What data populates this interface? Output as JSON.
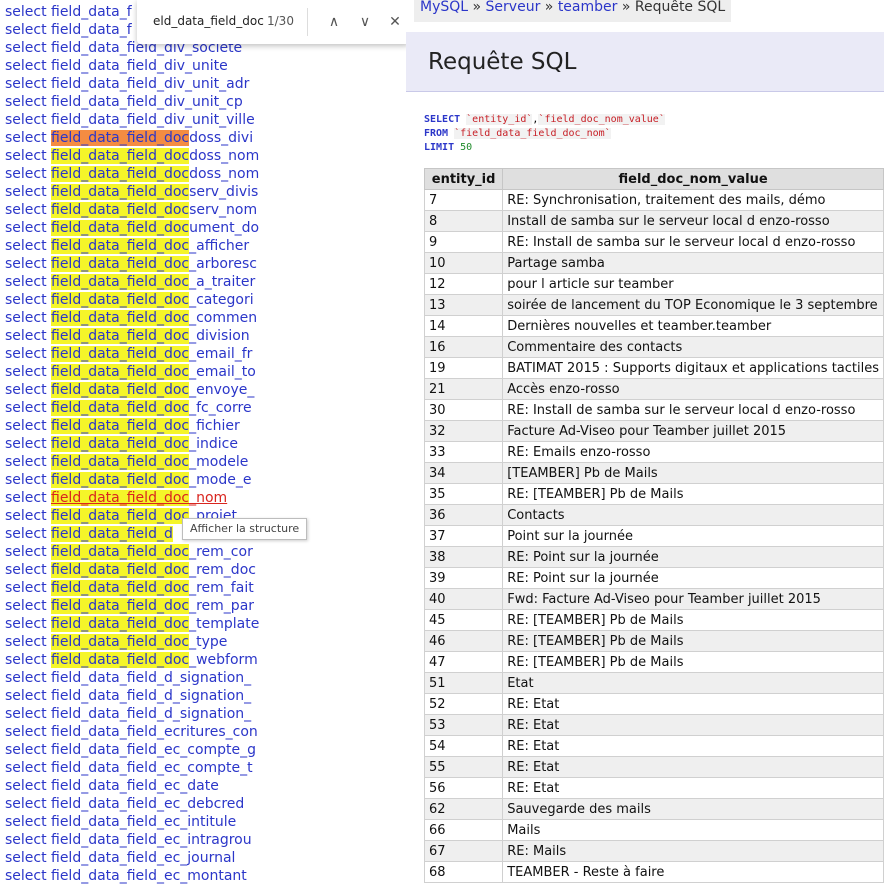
{
  "find_bar": {
    "query": "eld_data_field_doc",
    "count": "1/30",
    "prev": "∧",
    "next": "∨",
    "close": "✕"
  },
  "tooltip": "Afficher la structure",
  "left_list": [
    {
      "select": "select",
      "pre": "field_data_f",
      "hl": "",
      "suffix": ""
    },
    {
      "select": "select",
      "pre": "field_data_f",
      "hl": "",
      "suffix": ""
    },
    {
      "select": "select",
      "pre": "field_data_field_div_societe",
      "hl": "",
      "suffix": ""
    },
    {
      "select": "select",
      "pre": "field_data_field_div_unite",
      "hl": "",
      "suffix": ""
    },
    {
      "select": "select",
      "pre": "field_data_field_div_unit_adr",
      "hl": "",
      "suffix": ""
    },
    {
      "select": "select",
      "pre": "field_data_field_div_unit_cp",
      "hl": "",
      "suffix": ""
    },
    {
      "select": "select",
      "pre": "field_data_field_div_unit_ville",
      "hl": "",
      "suffix": ""
    },
    {
      "select": "select",
      "pre": "",
      "hl": "field_data_field_doc",
      "suffix": "doss_divi",
      "current": true
    },
    {
      "select": "select",
      "pre": "",
      "hl": "field_data_field_doc",
      "suffix": "doss_nom"
    },
    {
      "select": "select",
      "pre": "",
      "hl": "field_data_field_doc",
      "suffix": "doss_nom"
    },
    {
      "select": "select",
      "pre": "",
      "hl": "field_data_field_doc",
      "suffix": "serv_divis"
    },
    {
      "select": "select",
      "pre": "",
      "hl": "field_data_field_doc",
      "suffix": "serv_nom"
    },
    {
      "select": "select",
      "pre": "",
      "hl": "field_data_field_doc",
      "suffix": "ument_do"
    },
    {
      "select": "select",
      "pre": "",
      "hl": "field_data_field_doc",
      "suffix": "_afficher"
    },
    {
      "select": "select",
      "pre": "",
      "hl": "field_data_field_doc",
      "suffix": "_arboresc"
    },
    {
      "select": "select",
      "pre": "",
      "hl": "field_data_field_doc",
      "suffix": "_a_traiter"
    },
    {
      "select": "select",
      "pre": "",
      "hl": "field_data_field_doc",
      "suffix": "_categori"
    },
    {
      "select": "select",
      "pre": "",
      "hl": "field_data_field_doc",
      "suffix": "_commen"
    },
    {
      "select": "select",
      "pre": "",
      "hl": "field_data_field_doc",
      "suffix": "_division"
    },
    {
      "select": "select",
      "pre": "",
      "hl": "field_data_field_doc",
      "suffix": "_email_fr"
    },
    {
      "select": "select",
      "pre": "",
      "hl": "field_data_field_doc",
      "suffix": "_email_to"
    },
    {
      "select": "select",
      "pre": "",
      "hl": "field_data_field_doc",
      "suffix": "_envoye_"
    },
    {
      "select": "select",
      "pre": "",
      "hl": "field_data_field_doc",
      "suffix": "_fc_corre"
    },
    {
      "select": "select",
      "pre": "",
      "hl": "field_data_field_doc",
      "suffix": "_fichier"
    },
    {
      "select": "select",
      "pre": "",
      "hl": "field_data_field_doc",
      "suffix": "_indice"
    },
    {
      "select": "select",
      "pre": "",
      "hl": "field_data_field_doc",
      "suffix": "_modele"
    },
    {
      "select": "select",
      "pre": "",
      "hl": "field_data_field_doc",
      "suffix": "_mode_e"
    },
    {
      "select": "select",
      "pre": "",
      "hl": "field_data_field_doc",
      "suffix": "_nom",
      "hover": true
    },
    {
      "select": "select",
      "pre": "",
      "hl": "field_data_field_doc",
      "suffix": "_projet"
    },
    {
      "select": "select",
      "pre": "",
      "hl": "field_data_field_d",
      "suffix": ""
    },
    {
      "select": "select",
      "pre": "",
      "hl": "field_data_field_doc",
      "suffix": "_rem_cor"
    },
    {
      "select": "select",
      "pre": "",
      "hl": "field_data_field_doc",
      "suffix": "_rem_doc"
    },
    {
      "select": "select",
      "pre": "",
      "hl": "field_data_field_doc",
      "suffix": "_rem_fait"
    },
    {
      "select": "select",
      "pre": "",
      "hl": "field_data_field_doc",
      "suffix": "_rem_par"
    },
    {
      "select": "select",
      "pre": "",
      "hl": "field_data_field_doc",
      "suffix": "_template"
    },
    {
      "select": "select",
      "pre": "",
      "hl": "field_data_field_doc",
      "suffix": "_type"
    },
    {
      "select": "select",
      "pre": "",
      "hl": "field_data_field_doc",
      "suffix": "_webform"
    },
    {
      "select": "select",
      "pre": "field_data_field_d_signation_",
      "hl": "",
      "suffix": ""
    },
    {
      "select": "select",
      "pre": "field_data_field_d_signation_",
      "hl": "",
      "suffix": ""
    },
    {
      "select": "select",
      "pre": "field_data_field_d_signation_",
      "hl": "",
      "suffix": ""
    },
    {
      "select": "select",
      "pre": "field_data_field_ecritures_con",
      "hl": "",
      "suffix": ""
    },
    {
      "select": "select",
      "pre": "field_data_field_ec_compte_g",
      "hl": "",
      "suffix": ""
    },
    {
      "select": "select",
      "pre": "field_data_field_ec_compte_t",
      "hl": "",
      "suffix": ""
    },
    {
      "select": "select",
      "pre": "field_data_field_ec_date",
      "hl": "",
      "suffix": ""
    },
    {
      "select": "select",
      "pre": "field_data_field_ec_debcred",
      "hl": "",
      "suffix": ""
    },
    {
      "select": "select",
      "pre": "field_data_field_ec_intitule",
      "hl": "",
      "suffix": ""
    },
    {
      "select": "select",
      "pre": "field_data_field_ec_intragrou",
      "hl": "",
      "suffix": ""
    },
    {
      "select": "select",
      "pre": "field_data_field_ec_journal",
      "hl": "",
      "suffix": ""
    },
    {
      "select": "select",
      "pre": "field_data_field_ec_montant",
      "hl": "",
      "suffix": ""
    }
  ],
  "breadcrumb": {
    "mysql": "MySQL",
    "sep1": " » ",
    "server": "Serveur",
    "sep2": " » ",
    "db": "teamber",
    "sep3": " » ",
    "current": "Requête SQL"
  },
  "page_title": "Requête SQL",
  "sql": {
    "select_kw": "SELECT",
    "col1": "`entity_id`",
    "comma": ",",
    "col2": "`field_doc_nom_value`",
    "from_kw": "FROM",
    "table": "`field_data_field_doc_nom`",
    "limit_kw": "LIMIT",
    "limit": "50"
  },
  "table": {
    "headers": [
      "entity_id",
      "field_doc_nom_value"
    ],
    "rows": [
      [
        "7",
        "RE: Synchronisation, traitement des mails, démo"
      ],
      [
        "8",
        "Install de samba sur le serveur local d enzo-rosso"
      ],
      [
        "9",
        "RE: Install de samba sur le serveur local d enzo-rosso"
      ],
      [
        "10",
        "Partage samba"
      ],
      [
        "12",
        "pour l article sur teamber"
      ],
      [
        "13",
        "soirée de lancement du TOP Economique le 3 septembre"
      ],
      [
        "14",
        "Dernières nouvelles et teamber.teamber"
      ],
      [
        "16",
        "Commentaire des contacts"
      ],
      [
        "19",
        "BATIMAT 2015 : Supports digitaux et applications tactiles"
      ],
      [
        "21",
        "Accès enzo-rosso"
      ],
      [
        "30",
        "RE: Install de samba sur le serveur local d enzo-rosso"
      ],
      [
        "32",
        "Facture Ad-Viseo pour Teamber juillet 2015"
      ],
      [
        "33",
        "RE: Emails enzo-rosso"
      ],
      [
        "34",
        "[TEAMBER] Pb de Mails"
      ],
      [
        "35",
        "RE: [TEAMBER] Pb de Mails"
      ],
      [
        "36",
        "Contacts"
      ],
      [
        "37",
        "Point sur la journée"
      ],
      [
        "38",
        "RE: Point sur la journée"
      ],
      [
        "39",
        "RE: Point sur la journée"
      ],
      [
        "40",
        "Fwd: Facture Ad-Viseo pour Teamber juillet 2015"
      ],
      [
        "45",
        "RE: [TEAMBER] Pb de Mails"
      ],
      [
        "46",
        "RE: [TEAMBER] Pb de Mails"
      ],
      [
        "47",
        "RE: [TEAMBER] Pb de Mails"
      ],
      [
        "51",
        "Etat"
      ],
      [
        "52",
        "RE: Etat"
      ],
      [
        "53",
        "RE: Etat"
      ],
      [
        "54",
        "RE: Etat"
      ],
      [
        "55",
        "RE: Etat"
      ],
      [
        "56",
        "RE: Etat"
      ],
      [
        "62",
        "Sauvegarde des mails"
      ],
      [
        "66",
        "Mails"
      ],
      [
        "67",
        "RE: Mails"
      ],
      [
        "68",
        "TEAMBER - Reste à faire"
      ]
    ]
  },
  "colors": {
    "link": "#2b36c9",
    "highlight": "#f5f529",
    "current_highlight": "#f48c42",
    "hover_link": "#d9251f",
    "title_bg": "#eaeaf7"
  }
}
